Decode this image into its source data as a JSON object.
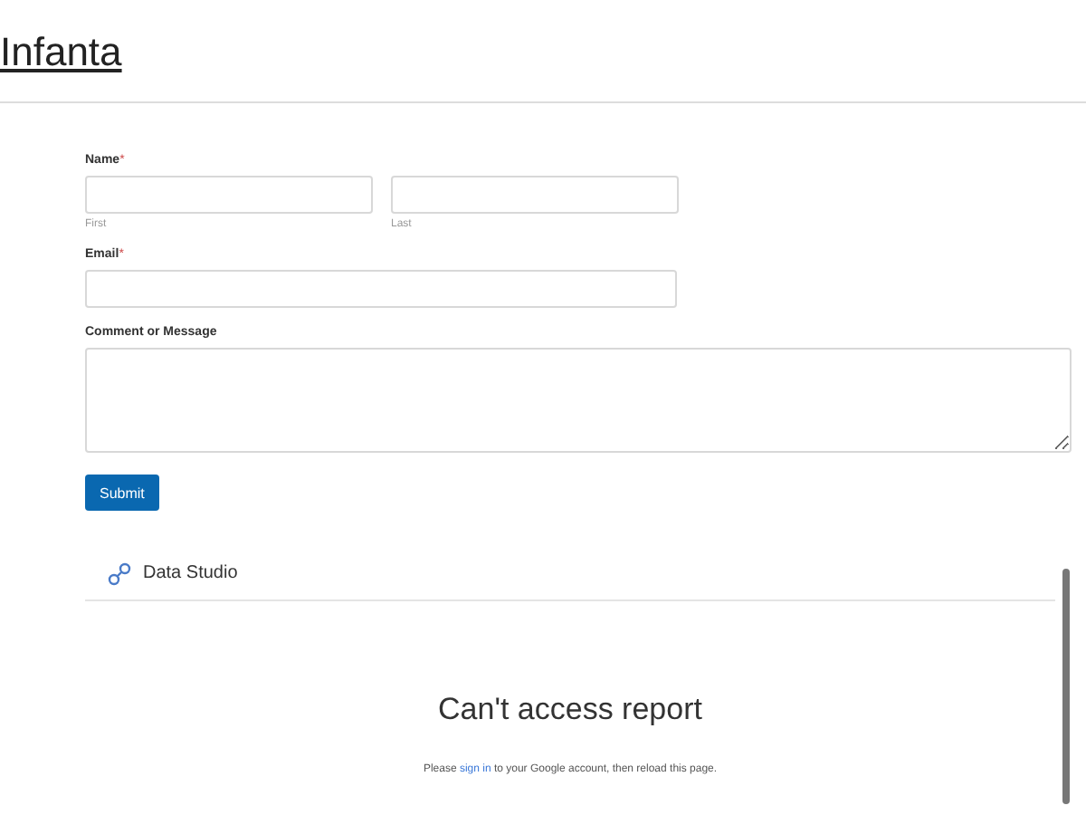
{
  "site_title": "Infanta",
  "form": {
    "fields": [
      {
        "kind": "name",
        "label": "Name",
        "required_mark": "*",
        "subfields": [
          {
            "sublabel": "First"
          },
          {
            "sublabel": "Last"
          }
        ]
      },
      {
        "kind": "text",
        "label": "Email",
        "required_mark": "*"
      },
      {
        "kind": "textarea",
        "label": "Comment or Message"
      }
    ],
    "submit": "Submit"
  },
  "embed": {
    "brand": "Data Studio",
    "heading": "Can't access report",
    "message_before": "Please ",
    "message_link": "sign in",
    "message_after": " to your Google account, then reload this page."
  }
}
